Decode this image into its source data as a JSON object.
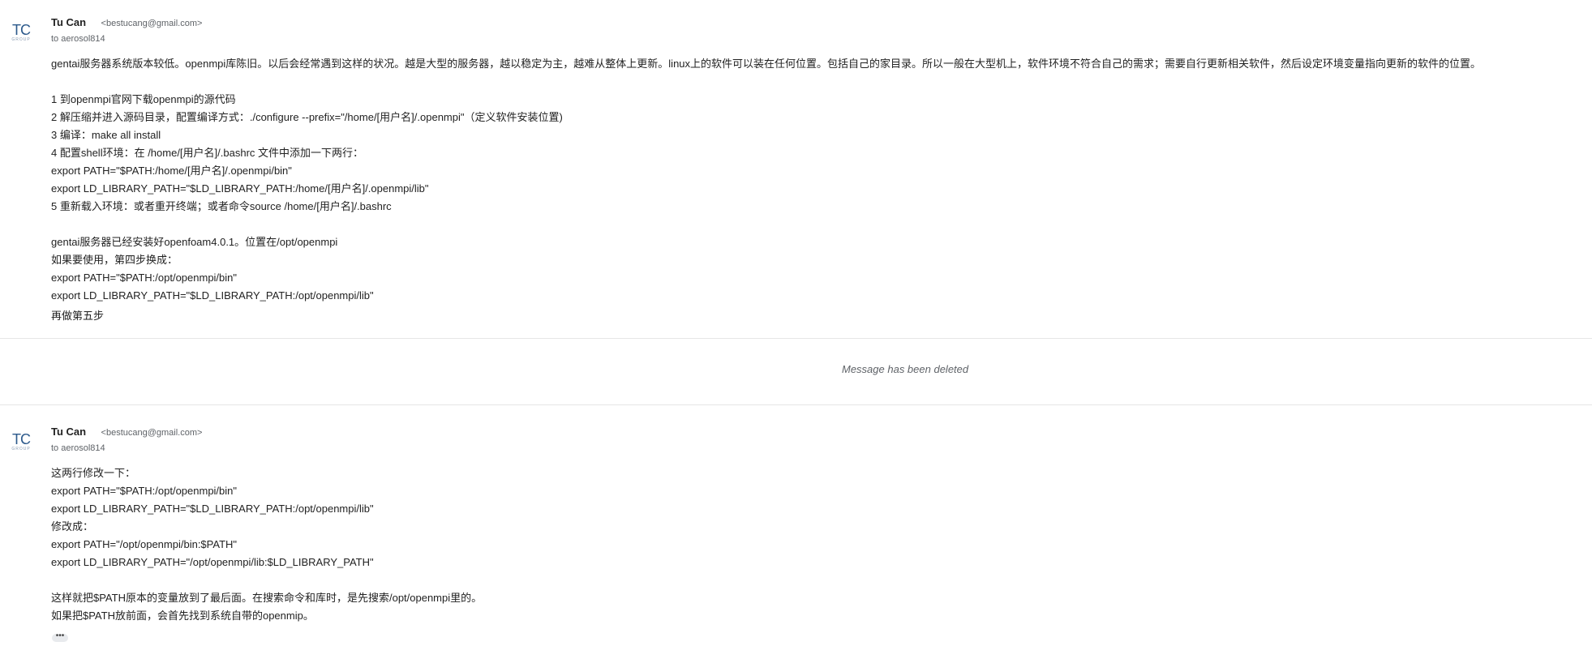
{
  "messages": [
    {
      "avatar": {
        "initials": "TC",
        "group": "GROUP"
      },
      "sender_name": "Tu Can",
      "sender_email": "<bestucang@gmail.com>",
      "recipient": "to aerosol814",
      "lines": [
        "gentai服务器系统版本较低。openmpi库陈旧。以后会经常遇到这样的状况。越是大型的服务器，越以稳定为主，越难从整体上更新。linux上的软件可以装在任何位置。包括自己的家目录。所以一般在大型机上，软件环境不符合自己的需求；需要自行更新相关软件，然后设定环境变量指向更新的软件的位置。",
        "",
        "1 到openmpi官网下载openmpi的源代码",
        "2 解压缩并进入源码目录，配置编译方式：./configure --prefix=\"/home/[用户名]/.openmpi\"（定义软件安装位置)",
        "3 编译：make all install",
        "4 配置shell环境：在 /home/[用户名]/.bashrc 文件中添加一下两行：",
        "export PATH=\"$PATH:/home/[用户名]/.openmpi/bin\"",
        "export LD_LIBRARY_PATH=\"$LD_LIBRARY_PATH:/home/[用户名]/.openmpi/lib\"",
        "5 重新载入环境：或者重开终端；或者命令source /home/[用户名]/.bashrc",
        "",
        "gentai服务器已经安装好openfoam4.0.1。位置在/opt/openmpi",
        "如果要使用，第四步换成：",
        "export PATH=\"$PATH:/opt/openmpi/bin\"",
        "export LD_LIBRARY_PATH=\"$LD_LIBRARY_PATH:/opt/openmpi/lib\""
      ],
      "closing": "再做第五步"
    },
    {
      "avatar": {
        "initials": "TC",
        "group": "GROUP"
      },
      "sender_name": "Tu Can",
      "sender_email": "<bestucang@gmail.com>",
      "recipient": "to aerosol814",
      "lines": [
        "这两行修改一下：",
        "export PATH=\"$PATH:/opt/openmpi/bin\"",
        "export LD_LIBRARY_PATH=\"$LD_LIBRARY_PATH:/opt/openmpi/lib\"",
        "修改成：",
        "export PATH=\"/opt/openmpi/bin:$PATH\"",
        "export LD_LIBRARY_PATH=\"/opt/openmpi/lib:$LD_LIBRARY_PATH\"",
        "",
        "这样就把$PATH原本的变量放到了最后面。在搜索命令和库时，是先搜索/opt/openmpi里的。",
        "如果把$PATH放前面，会首先找到系统自带的openmip。"
      ],
      "more_label": "•••"
    }
  ],
  "deleted_notice": "Message has been deleted",
  "colors": {
    "avatar_initials": "#2d5a8c",
    "divider": "#e6e6e6",
    "muted_text": "#5f6368"
  }
}
